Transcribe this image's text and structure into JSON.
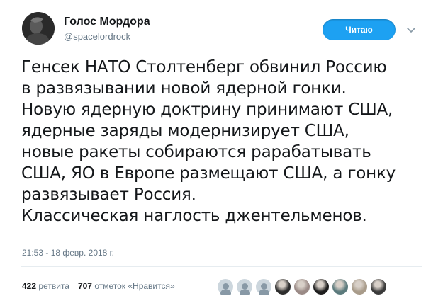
{
  "tweet": {
    "author": {
      "display_name": "Голос Мордора",
      "handle": "@spacelordrock",
      "avatar_icon": "user-avatar"
    },
    "follow_button_label": "Читаю",
    "menu_icon": "chevron-down-icon",
    "text_lines": [
      "Генсек НАТО Столтенберг обвинил Россию",
      "в развязывании новой ядерной гонки.",
      "Новую ядерную доктрину принимают США,",
      "ядерные заряды модернизирует США,",
      "новые ракеты собираются рарабатывать",
      "США, ЯО в Европе размещают США, а гонку",
      "развязывает Россия.",
      "Классическая наглость джентельменов."
    ],
    "timestamp": "21:53 - 18 февр. 2018 г.",
    "stats": {
      "retweets_count": "422",
      "retweets_label": "ретвита",
      "likes_count": "707",
      "likes_label": "отметок «Нравится»"
    },
    "likers": [
      {
        "name": "liker-1",
        "color": "#ccd6dd",
        "kind": "default"
      },
      {
        "name": "liker-2",
        "color": "#ccd6dd",
        "kind": "default"
      },
      {
        "name": "liker-3",
        "color": "#ccd6dd",
        "kind": "default"
      },
      {
        "name": "liker-4",
        "color": "#2d2d2d",
        "kind": "photo"
      },
      {
        "name": "liker-5",
        "color": "#9a8a86",
        "kind": "photo"
      },
      {
        "name": "liker-6",
        "color": "#1e1e1e",
        "kind": "photo"
      },
      {
        "name": "liker-7",
        "color": "#5b7a7c",
        "kind": "photo"
      },
      {
        "name": "liker-8",
        "color": "#a89b8a",
        "kind": "photo"
      },
      {
        "name": "liker-9",
        "color": "#3a3a3a",
        "kind": "photo"
      }
    ]
  },
  "colors": {
    "accent": "#1da1f2",
    "text": "#14171a",
    "secondary_text": "#657786",
    "divider": "#e6ecf0"
  }
}
